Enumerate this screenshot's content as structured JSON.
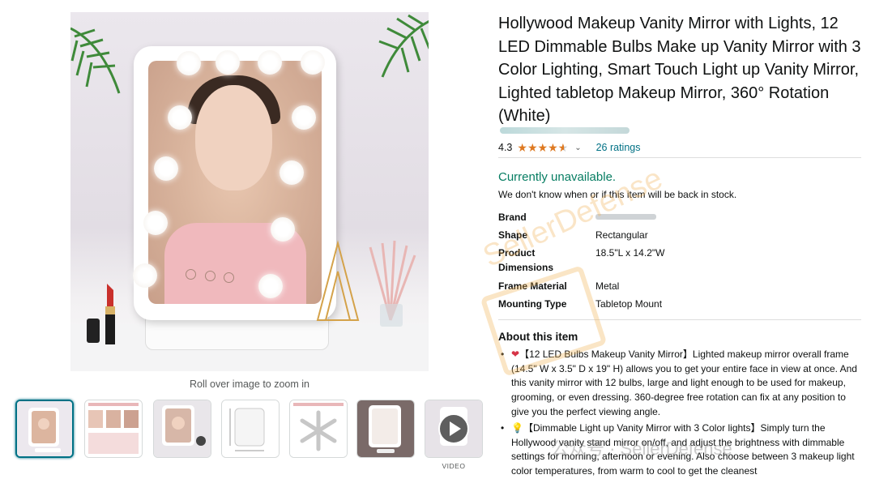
{
  "product": {
    "title": "Hollywood Makeup Vanity Mirror with Lights, 12 LED Dimmable Bulbs Make up Vanity Mirror with 3 Color Lighting, Smart Touch Light up Vanity Mirror, Lighted tabletop Makeup Mirror, 360° Rotation (White)",
    "rating_value": "4.3",
    "rating_stars": 4.3,
    "rating_chevron": "⌄",
    "ratings_count": "26 ratings",
    "availability": "Currently unavailable.",
    "availability_note": "We don't know when or if this item will be back in stock."
  },
  "gallery": {
    "zoom_hint": "Roll over image to zoom in",
    "touch_buttons": [
      "R",
      "◎",
      "◎"
    ],
    "video_label": "VIDEO",
    "thumbnail_icons": [
      "mirror-icon",
      "infographic-icon",
      "model-icon",
      "dimensions-icon",
      "rotation-icon",
      "mirror-icon",
      "play-icon"
    ]
  },
  "specs": [
    {
      "key": "Brand",
      "value": ""
    },
    {
      "key": "Shape",
      "value": "Rectangular"
    },
    {
      "key": "Product Dimensions",
      "value": "18.5\"L x 14.2\"W"
    },
    {
      "key": "Frame Material",
      "value": "Metal"
    },
    {
      "key": "Mounting Type",
      "value": "Tabletop Mount"
    }
  ],
  "about": {
    "title": "About this item",
    "bullets": [
      {
        "icon": "❤",
        "text": "【12 LED Bulbs Makeup Vanity Mirror】Lighted makeup mirror overall frame (14.5\" W x 3.5\" D x 19\" H) allows you to get your entire face in view at once. And this vanity mirror with 12 bulbs, large and light enough to be used for makeup, grooming, or even dressing. 360-degree free rotation can fix at any position to give you the perfect viewing angle."
      },
      {
        "icon": "💡",
        "text": "【Dimmable Light up Vanity Mirror with 3 Color lights】Simply turn the Hollywood vanity stand mirror on/off, and adjust the brightness with dimmable settings for morning, afternoon or evening. Also choose between 3 makeup light color temperatures, from warm to cool to get the cleanest"
      }
    ]
  },
  "watermarks": {
    "diagonal": "SellerDefense",
    "footer": "公众号 · SellerDefense"
  },
  "colors": {
    "link": "#007185",
    "available_green": "#067d62",
    "star": "#de7921",
    "thumb_selected": "#007185"
  }
}
